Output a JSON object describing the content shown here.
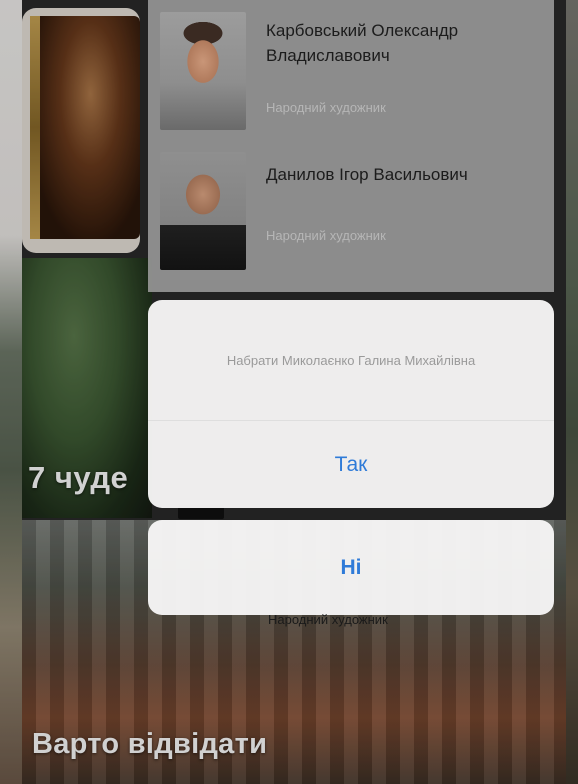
{
  "background": {
    "caption_top": "7 чуде",
    "caption_bottom": "Варто відвідати"
  },
  "people": [
    {
      "name": "Карбовський Олександр Владиславович",
      "subtitle": "Народний художник"
    },
    {
      "name": "Данилов Ігор Васильович",
      "subtitle": "Народний художник"
    }
  ],
  "alert": {
    "message": "Набрати Миколаєнко Галина Михайлівна",
    "confirm_label": "Так",
    "cancel_label": "Ні"
  },
  "under_label": "Народний художник",
  "colors": {
    "action_blue": "#2f7bd8",
    "sheet_bg": "#f7f6f6"
  }
}
